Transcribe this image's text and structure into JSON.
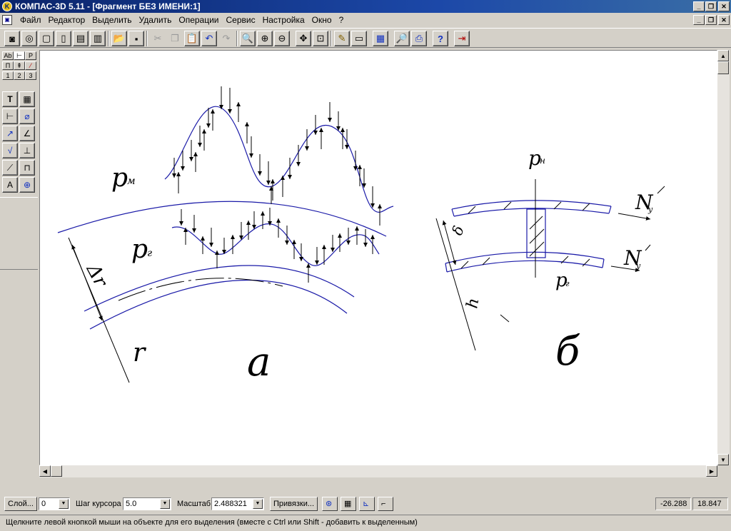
{
  "window": {
    "title": "КОМПАС-3D 5.11 - [Фрагмент БЕЗ ИМЕНИ:1]",
    "app_icon_glyph": "K"
  },
  "menu": {
    "items": [
      "Файл",
      "Редактор",
      "Выделить",
      "Удалить",
      "Операции",
      "Сервис",
      "Настройка",
      "Окно",
      "?"
    ]
  },
  "window_controls": {
    "minimize": "_",
    "restore": "❐",
    "close": "✕"
  },
  "left_panel": {
    "small_buttons": [
      "Ab",
      "⊢",
      "P",
      "П",
      "⇞",
      "⁄",
      "1",
      "2",
      "3"
    ]
  },
  "drawing": {
    "label_pm": "p",
    "label_pm_sub": "м",
    "label_pg": "p",
    "label_pg_sub": "г",
    "label_delta_r": "Δr",
    "label_r": "r",
    "label_a": "а",
    "label_pn": "p",
    "label_pn_sub": "н",
    "label_delta": "δ",
    "label_n_top": "N",
    "label_n_top_sub": "y",
    "label_n_bottom": "N",
    "label_n_bottom_sub": "y",
    "label_pr": "p",
    "label_pr_sub": "г",
    "label_h": "h",
    "label_b": "б"
  },
  "bottom_bar": {
    "layer_button": "Слой...",
    "layer_value": "0",
    "cursor_step_label": "Шаг курсора",
    "cursor_step_value": "5.0",
    "scale_label": "Масштаб",
    "scale_value": "2.488321",
    "snaps_button": "Привязки...",
    "coord_x": "-26.288",
    "coord_y": "18.847"
  },
  "status_bar": {
    "message": "Щелкните левой кнопкой мыши на объекте для его выделения (вместе с Ctrl или Shift - добавить к выделенным)"
  },
  "colors": {
    "drawing_blue": "#1a1aa8",
    "titlebar_start": "#0a246a",
    "face": "#d4d0c8"
  }
}
